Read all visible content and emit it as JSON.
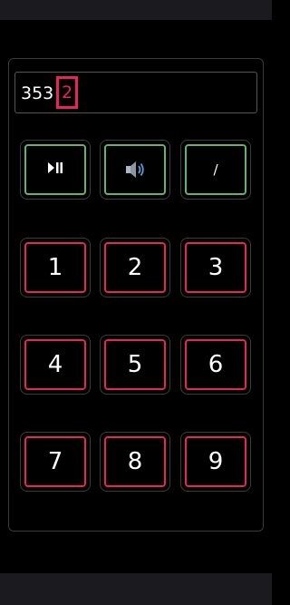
{
  "display": {
    "entered": "353",
    "current_digit": "2"
  },
  "controls": {
    "play_pause": "⏯",
    "speaker": "speaker-icon",
    "slash": "/"
  },
  "keypad": [
    "1",
    "2",
    "3",
    "4",
    "5",
    "6",
    "7",
    "8",
    "9"
  ],
  "colors": {
    "accent_pink": "#e8245c",
    "accent_green": "#5fb470",
    "background": "#000000",
    "bar": "#1b1a1f"
  }
}
